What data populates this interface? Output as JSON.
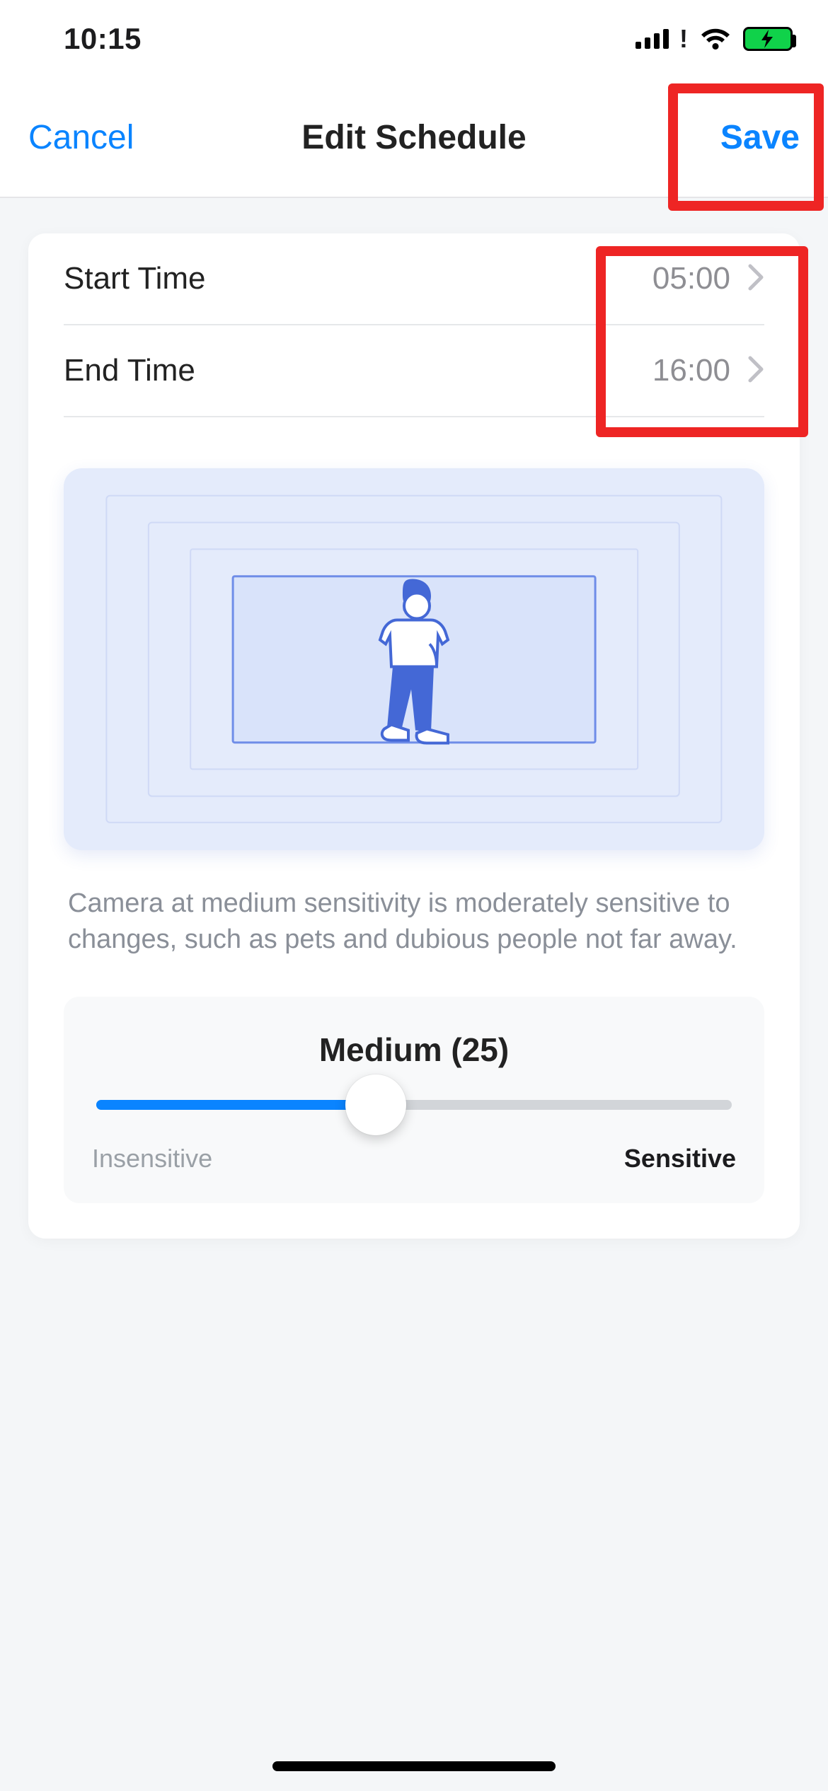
{
  "status": {
    "time": "10:15"
  },
  "nav": {
    "cancel_label": "Cancel",
    "title": "Edit Schedule",
    "save_label": "Save"
  },
  "schedule": {
    "start_label": "Start Time",
    "start_value": "05:00",
    "end_label": "End Time",
    "end_value": "16:00"
  },
  "description": "Camera at medium sensitivity is moderately sensitive to changes, such as pets and dubious people not far away.",
  "sensitivity": {
    "title": "Medium (25)",
    "value": 25,
    "fill_percent": 44,
    "min_label": "Insensitive",
    "max_label": "Sensitive"
  },
  "colors": {
    "accent": "#0a84ff",
    "highlight": "#ee2524",
    "battery": "#10d24a"
  },
  "highlights": {
    "save_button": true,
    "time_values": true
  }
}
